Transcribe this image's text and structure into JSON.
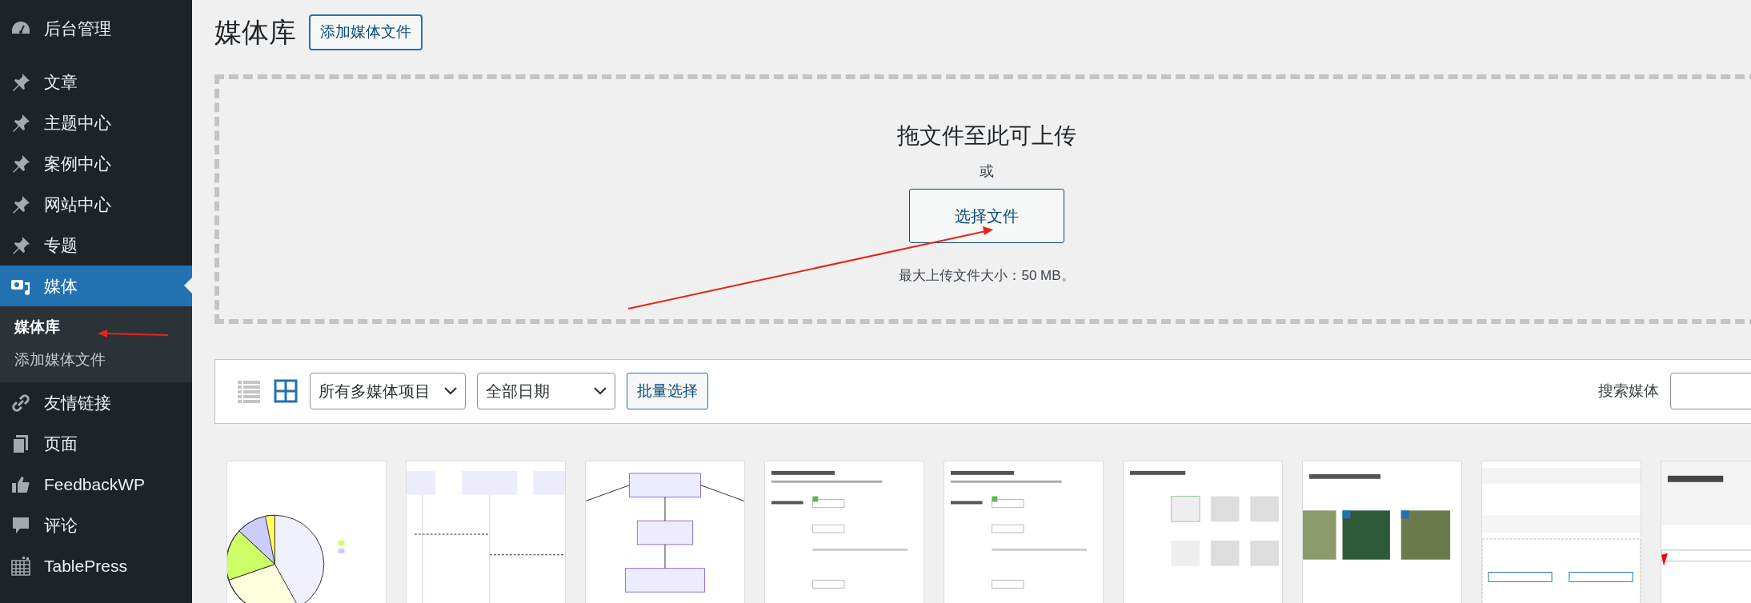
{
  "sidebar": {
    "groups": [
      {
        "items": [
          {
            "label": "后台管理",
            "selected": false
          }
        ]
      },
      {
        "items": [
          {
            "label": "文章",
            "selected": false
          },
          {
            "label": "主题中心",
            "selected": false
          },
          {
            "label": "案例中心",
            "selected": false
          },
          {
            "label": "网站中心",
            "selected": false
          },
          {
            "label": "专题",
            "selected": false
          },
          {
            "label": "媒体",
            "selected": true,
            "children": [
              {
                "label": "媒体库",
                "selected": true
              },
              {
                "label": "添加媒体文件",
                "selected": false
              }
            ]
          },
          {
            "label": "友情链接",
            "selected": false
          },
          {
            "label": "页面",
            "selected": false
          },
          {
            "label": "FeedbackWP",
            "selected": false
          },
          {
            "label": "评论",
            "selected": false
          },
          {
            "label": "TablePress",
            "selected": false
          }
        ]
      }
    ]
  },
  "page": {
    "title": "媒体库",
    "add_button": "添加媒体文件"
  },
  "uploader": {
    "heading": "拖文件至此可上传",
    "or": "或",
    "select_button": "选择文件",
    "max_size": "最大上传文件大小：50 MB。"
  },
  "toolbar": {
    "views": [
      {
        "selected": false
      },
      {
        "selected": true
      }
    ],
    "filters": [
      {
        "value": "所有多媒体项目"
      },
      {
        "value": "全部日期"
      }
    ],
    "bulk_button": "批量选择",
    "search_label": "搜索媒体"
  },
  "thumbnails": [
    {
      "kind": "pie-chart"
    },
    {
      "kind": "sequence-diagram"
    },
    {
      "kind": "flow-diagram"
    },
    {
      "kind": "settings-page"
    },
    {
      "kind": "settings-page"
    },
    {
      "kind": "layout-page"
    },
    {
      "kind": "gallery-page"
    },
    {
      "kind": "upload-page"
    },
    {
      "kind": "license-page"
    }
  ]
}
